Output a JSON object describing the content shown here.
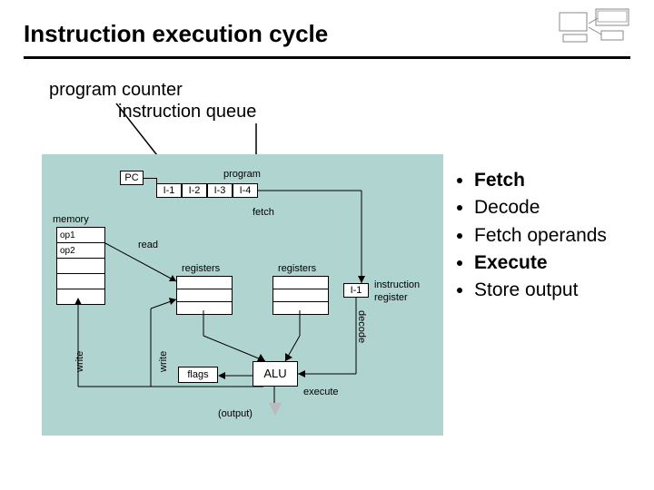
{
  "title": "Instruction execution cycle",
  "annotations": {
    "program_counter": "program counter",
    "instruction_queue": "instruction queue"
  },
  "bullets": [
    {
      "text": "Fetch",
      "bold": true
    },
    {
      "text": "Decode",
      "bold": false
    },
    {
      "text": "Fetch operands",
      "bold": false
    },
    {
      "text": "Execute",
      "bold": true
    },
    {
      "text": "Store output",
      "bold": false
    }
  ],
  "diagram": {
    "pc": "PC",
    "program": "program",
    "i1": "I-1",
    "i2": "I-2",
    "i3": "I-3",
    "i4": "I-4",
    "memory": "memory",
    "op1": "op1",
    "op2": "op2",
    "read": "read",
    "fetch": "fetch",
    "registers": "registers",
    "instr_reg_box": "I-1",
    "instruction": "instruction",
    "register_word": "register",
    "decode": "decode",
    "write_v1": "write",
    "write_v2": "write",
    "flags": "flags",
    "alu": "ALU",
    "execute_lbl": "execute",
    "output": "(output)"
  }
}
